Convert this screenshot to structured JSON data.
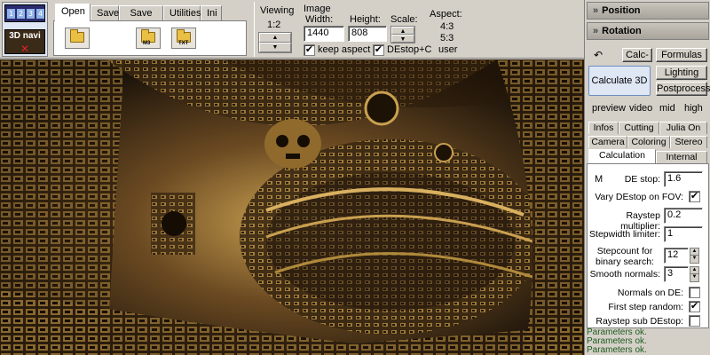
{
  "toolbar": {
    "logo_text": "3D navi",
    "film_numbers": [
      "1",
      "2",
      "3",
      "4"
    ],
    "tabs": [
      "Open",
      "Save",
      "Save pic",
      "Utilities",
      "Ini"
    ],
    "active_tab": "Open",
    "file_buttons": [
      {
        "icon": "folder-open-icon",
        "tag": ""
      },
      {
        "icon": "folder-image-icon",
        "tag": "M3"
      },
      {
        "icon": "folder-txt-icon",
        "tag": "TXT"
      }
    ]
  },
  "viewing": {
    "title": "Viewing",
    "ratio": "1:2"
  },
  "image": {
    "title": "Image",
    "width_label": "Width:",
    "width_value": "1440",
    "height_label": "Height:",
    "height_value": "808",
    "scale_label": "Scale:",
    "keep_aspect_label": "keep aspect",
    "keep_aspect_checked": true,
    "de_stop_c_label": "DEstop+C",
    "de_stop_c_checked": true
  },
  "aspect": {
    "title": "Aspect:",
    "options": [
      "4:3",
      "5:3",
      "user"
    ]
  },
  "right_panel": {
    "position_label": "Position",
    "rotation_label": "Rotation",
    "undo_icon": "undo-icon",
    "calc_minus_label": "Calc-",
    "formulas_label": "Formulas",
    "calculate_label": "Calculate 3D",
    "lighting_label": "Lighting",
    "postprocess_label": "Postprocess",
    "quality_options": [
      "preview",
      "video",
      "mid",
      "high"
    ],
    "tabs_row1": [
      "Infos",
      "Cutting",
      "Julia On"
    ],
    "tabs_row2": [
      "Camera",
      "Coloring",
      "Stereo"
    ],
    "tabs_row3": [
      "Calculation",
      "Internal"
    ],
    "active_tab": "Calculation"
  },
  "calculation": {
    "m_label": "M",
    "de_stop_label": "DE stop:",
    "de_stop_value": "1.6",
    "vary_label": "Vary DEstop on FOV:",
    "vary_checked": true,
    "raystep_label": "Raystep multiplier:",
    "raystep_value": "0.2",
    "stepwidth_label": "Stepwidth limiter:",
    "stepwidth_value": "1",
    "stepcount_label": "Stepcount for binary search:",
    "stepcount_value": "12",
    "smooth_label": "Smooth normals:",
    "smooth_value": "3",
    "normals_de_label": "Normals on DE:",
    "normals_de_checked": false,
    "first_step_label": "First step random:",
    "first_step_checked": true,
    "raystep_sub_label": "Raystep sub DEstop:",
    "raystep_sub_checked": false
  },
  "status": [
    "Parameters ok.",
    "Parameters ok.",
    "Parameters ok."
  ],
  "colors": {
    "panel": "#d4d0c8",
    "status_text": "#1e5c1e",
    "fractal_gold": "#b8903f"
  }
}
